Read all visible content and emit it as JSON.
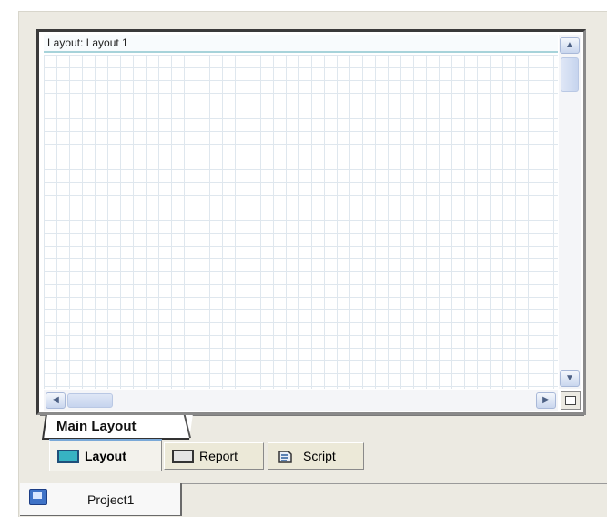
{
  "editor": {
    "title": "Layout: Layout 1"
  },
  "scrollbars": {
    "up_icon": "▲",
    "down_icon": "▼",
    "left_icon": "◀",
    "right_icon": "▶"
  },
  "page_tabs": {
    "active_label": "Main Layout"
  },
  "view_tabs": {
    "layout_label": "Layout",
    "report_label": "Report",
    "script_label": "Script",
    "active": "Layout"
  },
  "project_tab": {
    "label": "Project1"
  },
  "colors": {
    "accent": "#7aa9d8",
    "grid_line": "#dfe7ee",
    "panel_bg": "#eceae2"
  }
}
